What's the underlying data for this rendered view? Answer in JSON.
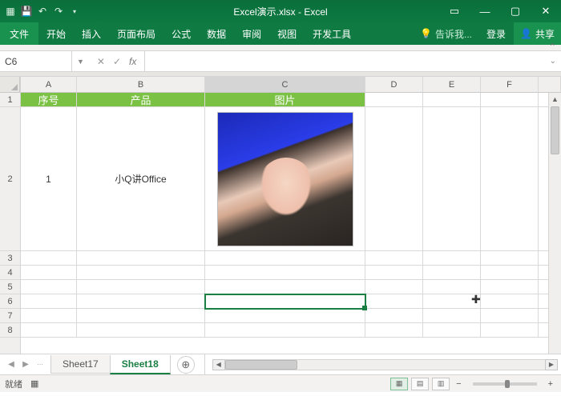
{
  "titlebar": {
    "title": "Excel演示.xlsx - Excel"
  },
  "menubar": {
    "file": "文件",
    "tabs": [
      "开始",
      "插入",
      "页面布局",
      "公式",
      "数据",
      "审阅",
      "视图",
      "开发工具"
    ],
    "tell": "告诉我...",
    "login": "登录",
    "share": "共享"
  },
  "namebox": {
    "value": "C6"
  },
  "formula": {
    "fx_label": "fx",
    "value": ""
  },
  "grid": {
    "col_letters": [
      "A",
      "B",
      "C",
      "D",
      "E",
      "F"
    ],
    "row_numbers": [
      "1",
      "2",
      "3",
      "4",
      "5",
      "6",
      "7",
      "8"
    ],
    "header_row": {
      "a": "序号",
      "b": "产品",
      "c": "图片"
    },
    "data_row": {
      "a": "1",
      "b": "小Q讲Office"
    },
    "selected_cell": "C6"
  },
  "sheets": {
    "items": [
      {
        "name": "Sheet17",
        "active": false
      },
      {
        "name": "Sheet18",
        "active": true
      }
    ]
  },
  "statusbar": {
    "ready": "就绪",
    "zoom_minus": "−",
    "zoom_plus": "+"
  }
}
